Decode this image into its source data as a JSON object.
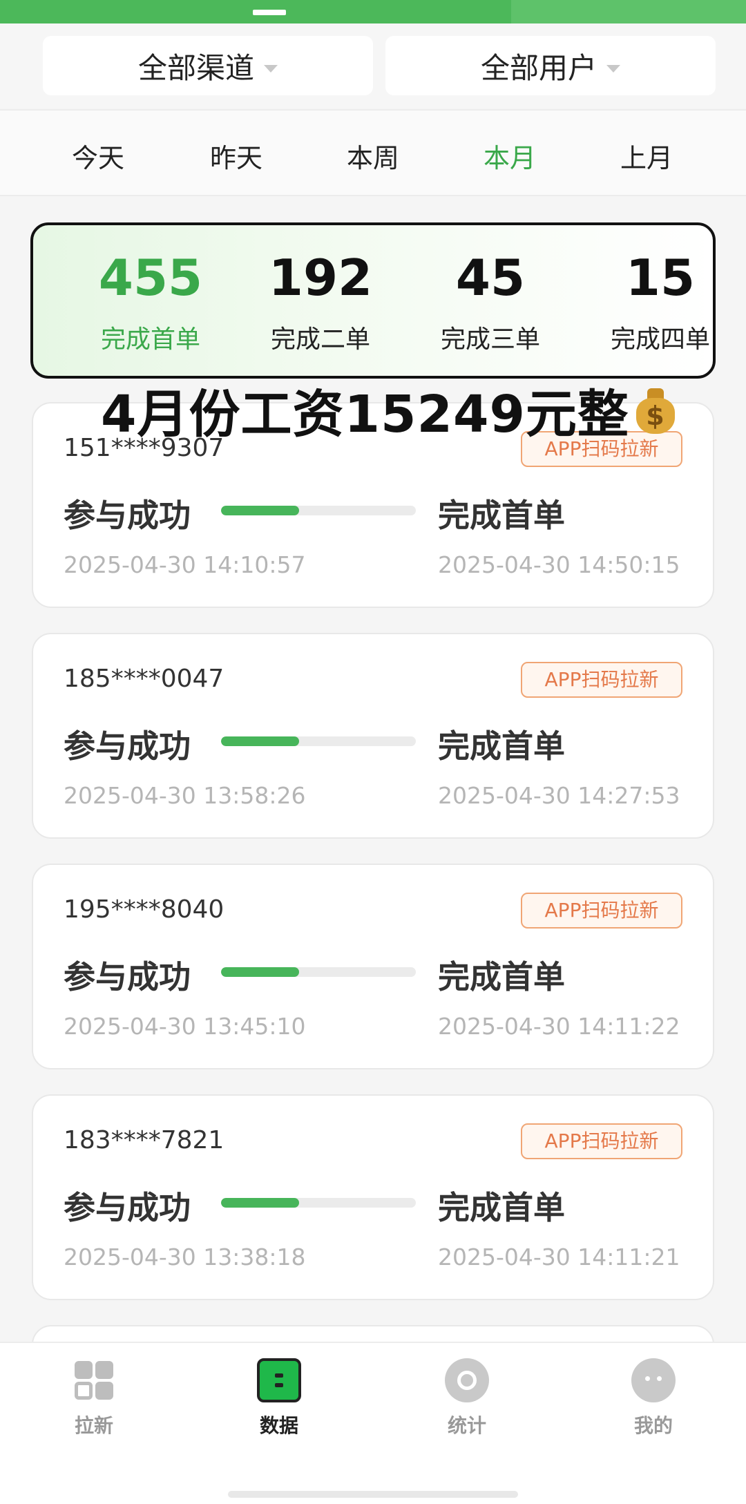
{
  "filters": {
    "channel": "全部渠道",
    "user": "全部用户"
  },
  "tabs": [
    "今天",
    "昨天",
    "本周",
    "本月",
    "上月"
  ],
  "active_tab": "本月",
  "stats": [
    {
      "value": "455",
      "label": "完成首单"
    },
    {
      "value": "192",
      "label": "完成二单"
    },
    {
      "value": "45",
      "label": "完成三单"
    },
    {
      "value": "15",
      "label": "完成四单"
    }
  ],
  "caption": "4月份工资15249元整",
  "records": [
    {
      "phone": "151****9307",
      "badge": "APP扫码拉新",
      "step1": "参与成功",
      "step2": "完成首单",
      "progress": 0.4,
      "time1": "2025-04-30 14:10:57",
      "time2": "2025-04-30 14:50:15"
    },
    {
      "phone": "185****0047",
      "badge": "APP扫码拉新",
      "step1": "参与成功",
      "step2": "完成首单",
      "progress": 0.4,
      "time1": "2025-04-30 13:58:26",
      "time2": "2025-04-30 14:27:53"
    },
    {
      "phone": "195****8040",
      "badge": "APP扫码拉新",
      "step1": "参与成功",
      "step2": "完成首单",
      "progress": 0.4,
      "time1": "2025-04-30 13:45:10",
      "time2": "2025-04-30 14:11:22"
    },
    {
      "phone": "183****7821",
      "badge": "APP扫码拉新",
      "step1": "参与成功",
      "step2": "完成首单",
      "progress": 0.4,
      "time1": "2025-04-30 13:38:18",
      "time2": "2025-04-30 14:11:21"
    }
  ],
  "nav": [
    {
      "label": "拉新",
      "icon": "grid-icon"
    },
    {
      "label": "数据",
      "icon": "data-icon"
    },
    {
      "label": "统计",
      "icon": "stats-icon"
    },
    {
      "label": "我的",
      "icon": "profile-icon"
    }
  ],
  "active_nav": "数据",
  "colors": {
    "accent": "#3aa84a",
    "badge": "#e4794a",
    "progress": "#47b55a"
  }
}
